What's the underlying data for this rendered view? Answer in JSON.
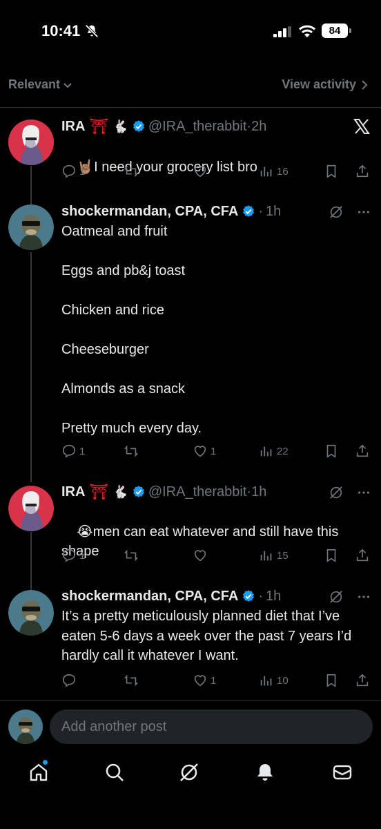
{
  "status_bar": {
    "time": "10:41",
    "battery": "84"
  },
  "filter": {
    "sort_label": "Relevant",
    "view_activity_label": "View activity"
  },
  "posts": [
    {
      "name": "IRA",
      "handle": "@IRA_therabbit",
      "time": "2h",
      "emoji_prefix": "🤘🏽",
      "text": "I need your grocery list bro",
      "replies": "1",
      "reposts": "",
      "likes": "",
      "views": "16",
      "badge_icons": [
        "torii-gate-emoji",
        "rabbit-emoji"
      ]
    },
    {
      "name": "shockermandan, CPA, CFA",
      "handle": "",
      "time": "1h",
      "emoji_prefix": "",
      "text": "Oatmeal and fruit\n\nEggs and pb&j toast\n\nChicken and rice\n\nCheeseburger\n\nAlmonds as a snack\n\nPretty much every day.",
      "replies": "1",
      "reposts": "",
      "likes": "1",
      "views": "22"
    },
    {
      "name": "IRA",
      "handle": "@IRA_therabbit",
      "time": "1h",
      "emoji_prefix": "😭",
      "text": "men can eat whatever and still have this shape",
      "replies": "1",
      "reposts": "",
      "likes": "",
      "views": "15",
      "badge_icons": [
        "torii-gate-emoji",
        "rabbit-emoji"
      ]
    },
    {
      "name": "shockermandan, CPA, CFA",
      "handle": "",
      "time": "1h",
      "emoji_prefix": "",
      "text": "It’s a pretty meticulously planned diet that I’ve eaten 5-6 days a week over the past 7 years I’d hardly call it whatever I want.",
      "replies": "",
      "reposts": "",
      "likes": "1",
      "views": "10"
    }
  ],
  "separator": "·",
  "composer": {
    "placeholder": "Add another post"
  },
  "colors": {
    "background": "#000000",
    "text": "#e7e9ea",
    "muted": "#71767b",
    "verified": "#1d9bf0",
    "accent_red": "#f4212e"
  }
}
